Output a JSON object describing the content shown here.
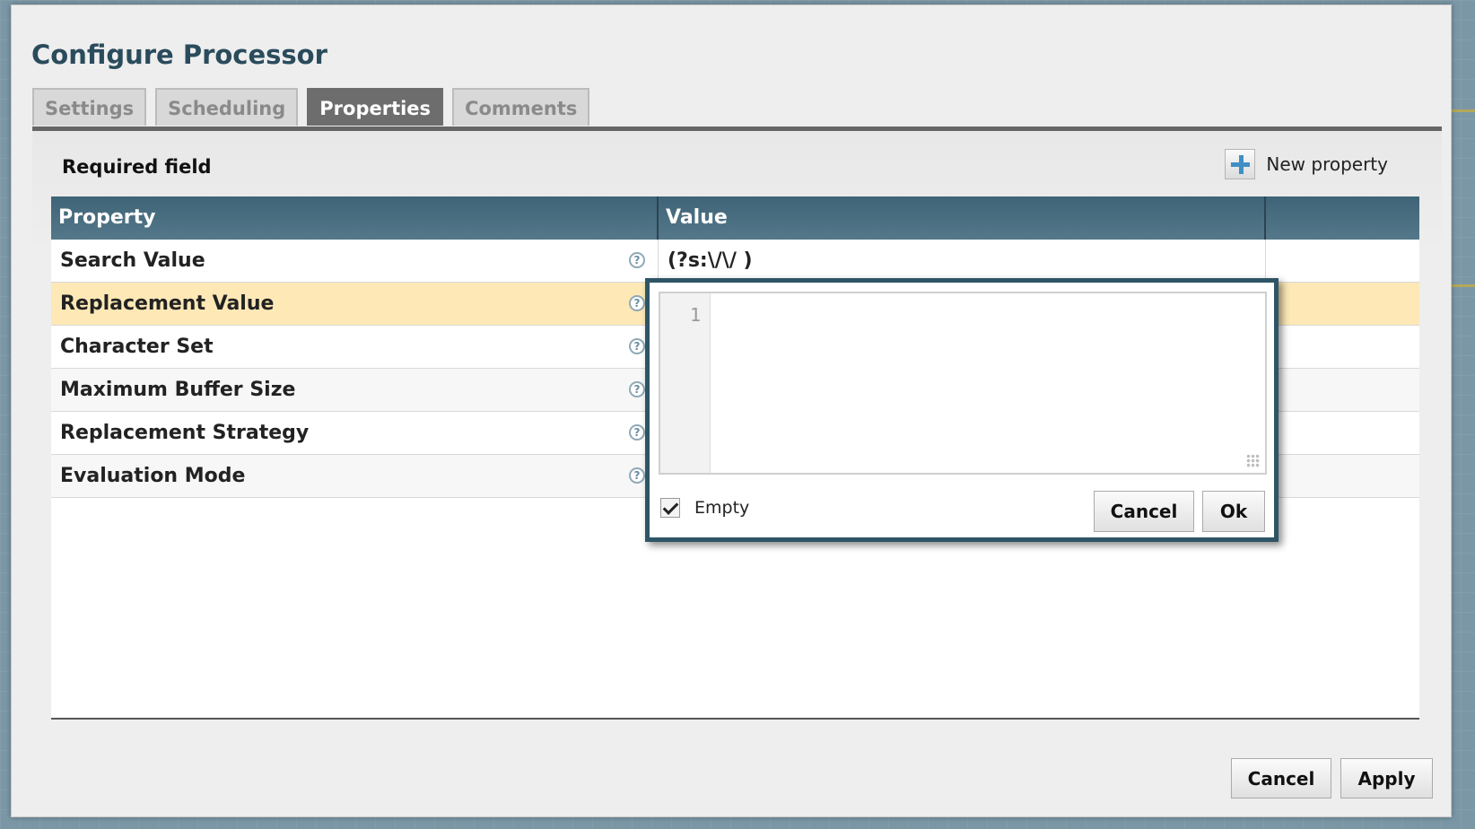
{
  "dialog": {
    "title": "Configure Processor",
    "tabs": [
      {
        "label": "Settings",
        "active": false
      },
      {
        "label": "Scheduling",
        "active": false
      },
      {
        "label": "Properties",
        "active": true
      },
      {
        "label": "Comments",
        "active": false
      }
    ]
  },
  "properties_tab": {
    "required_label": "Required field",
    "new_property_label": "New property",
    "table": {
      "columns": [
        "Property",
        "Value",
        ""
      ],
      "rows": [
        {
          "name": "Search Value",
          "value": "(?s:\\/\\/ )",
          "selected": false
        },
        {
          "name": "Replacement Value",
          "value": "",
          "selected": true
        },
        {
          "name": "Character Set",
          "value": "",
          "selected": false
        },
        {
          "name": "Maximum Buffer Size",
          "value": "",
          "selected": false
        },
        {
          "name": "Replacement Strategy",
          "value": "",
          "selected": false
        },
        {
          "name": "Evaluation Mode",
          "value": "",
          "selected": false
        }
      ],
      "help_icon_glyph": "?"
    }
  },
  "value_editor": {
    "line_number": "1",
    "content": "",
    "empty_label": "Empty",
    "empty_checked": true,
    "cancel_label": "Cancel",
    "ok_label": "Ok"
  },
  "footer": {
    "cancel_label": "Cancel",
    "apply_label": "Apply"
  },
  "colors": {
    "header": "#3f6477",
    "selected_row": "#fde8b6",
    "title": "#2a4b5c",
    "editor_border": "#2e5566"
  }
}
